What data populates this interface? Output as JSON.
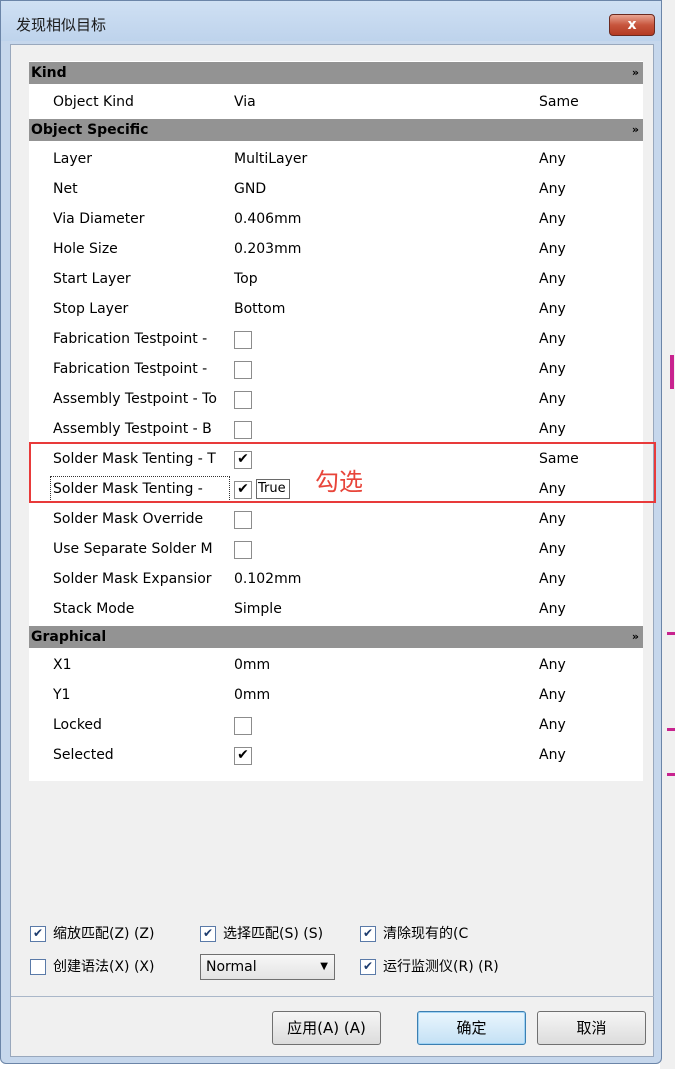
{
  "window": {
    "title": "发现相似目标",
    "close_label": "x"
  },
  "sections": {
    "kind": {
      "label": "Kind"
    },
    "object_specific": {
      "label": "Object Specific"
    },
    "graphical": {
      "label": "Graphical"
    },
    "chevron": "»"
  },
  "rows": {
    "object_kind": {
      "label": "Object Kind",
      "value": "Via",
      "match": "Same"
    },
    "layer": {
      "label": "Layer",
      "value": "MultiLayer",
      "match": "Any"
    },
    "net": {
      "label": "Net",
      "value": "GND",
      "match": "Any"
    },
    "via_diameter": {
      "label": "Via Diameter",
      "value": "0.406mm",
      "match": "Any"
    },
    "hole_size": {
      "label": "Hole Size",
      "value": "0.203mm",
      "match": "Any"
    },
    "start_layer": {
      "label": "Start Layer",
      "value": "Top",
      "match": "Any"
    },
    "stop_layer": {
      "label": "Stop Layer",
      "value": "Bottom",
      "match": "Any"
    },
    "fab_testpoint_top": {
      "label": "Fabrication Testpoint - ",
      "checked": false,
      "match": "Any"
    },
    "fab_testpoint_bottom": {
      "label": "Fabrication Testpoint - ",
      "checked": false,
      "match": "Any"
    },
    "asm_testpoint_top": {
      "label": "Assembly Testpoint - To",
      "checked": false,
      "match": "Any"
    },
    "asm_testpoint_bottom": {
      "label": "Assembly Testpoint - B",
      "checked": false,
      "match": "Any"
    },
    "solder_mask_tenting_top": {
      "label": "Solder Mask Tenting - T",
      "checked": true,
      "match": "Same"
    },
    "solder_mask_tenting_bottom": {
      "label": "Solder Mask Tenting - ",
      "checked": true,
      "value_text": "True",
      "match": "Any"
    },
    "solder_mask_override": {
      "label": "Solder Mask Override",
      "checked": false,
      "match": "Any"
    },
    "use_separate_solder_mask": {
      "label": "Use Separate Solder M",
      "checked": false,
      "match": "Any"
    },
    "solder_mask_expansion": {
      "label": "Solder Mask Expansior",
      "value": "0.102mm",
      "match": "Any"
    },
    "stack_mode": {
      "label": "Stack Mode",
      "value": "Simple",
      "match": "Any"
    },
    "x1": {
      "label": "X1",
      "value": "0mm",
      "match": "Any"
    },
    "y1": {
      "label": "Y1",
      "value": "0mm",
      "match": "Any"
    },
    "locked": {
      "label": "Locked",
      "checked": false,
      "match": "Any"
    },
    "selected": {
      "label": "Selected",
      "checked": true,
      "match": "Any"
    }
  },
  "annotation": {
    "text": "勾选"
  },
  "options": {
    "zoom_match": {
      "label": "缩放匹配(Z) (Z)",
      "checked": true
    },
    "select_match": {
      "label": "选择匹配(S) (S)",
      "checked": true
    },
    "clear_existing": {
      "label": "清除现有的(C",
      "checked": true
    },
    "create_expression": {
      "label": "创建语法(X) (X)",
      "checked": false
    },
    "run_inspector": {
      "label": "运行监测仪(R) (R)",
      "checked": true
    },
    "mode_select": {
      "value": "Normal"
    }
  },
  "buttons": {
    "apply": "应用(A) (A)",
    "ok": "确定",
    "cancel": "取消"
  },
  "glyphs": {
    "check": "✔",
    "dropdown": "▼"
  },
  "colors": {
    "highlight": "#e83a3a",
    "section_bg": "#939393"
  }
}
